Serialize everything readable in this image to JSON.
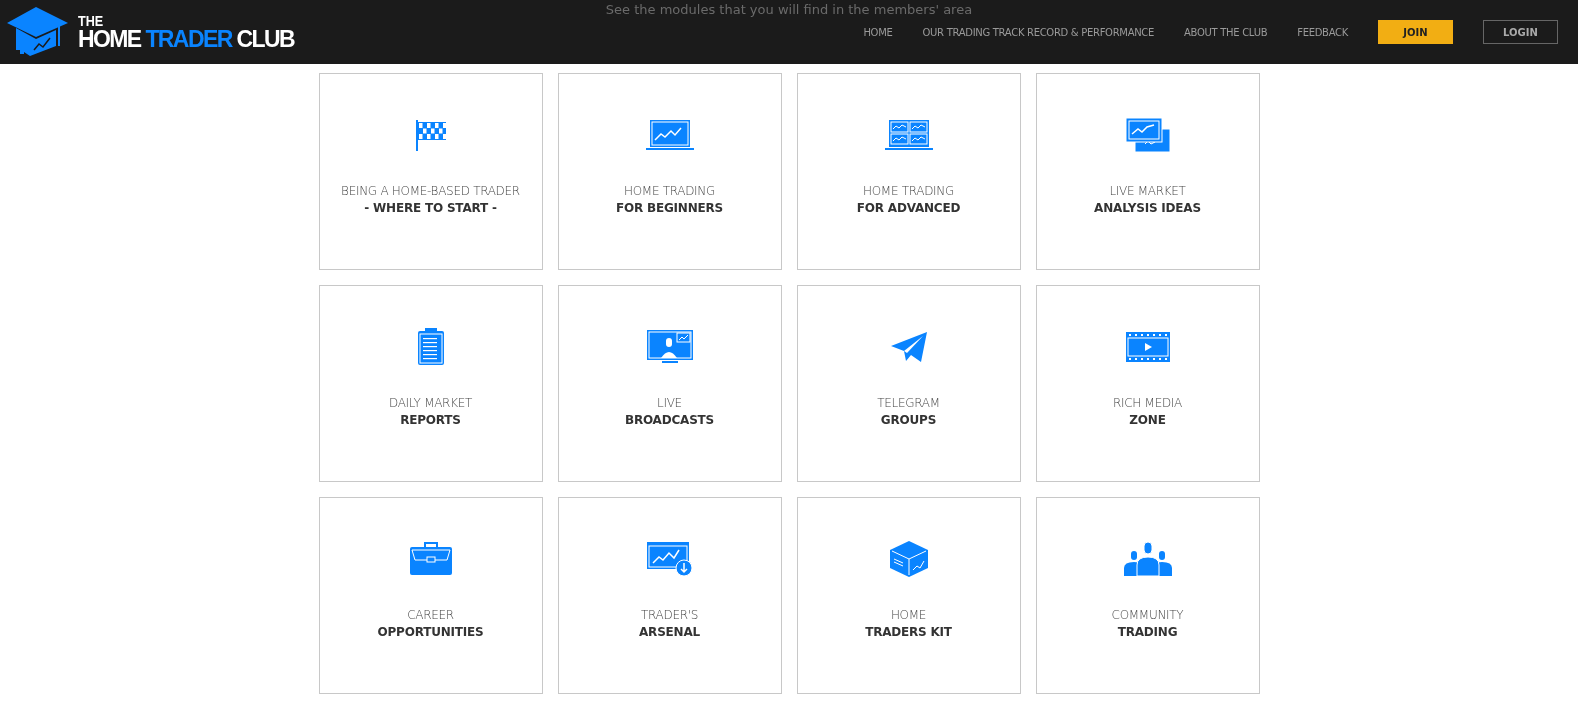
{
  "header": {
    "logo": {
      "line_1": "THE",
      "word_1": "HOME",
      "word_2": "TRADER",
      "word_3": "CLUB"
    },
    "hidden_intro": "See the modules that you will find in the members' area",
    "nav": [
      {
        "label": "HOME"
      },
      {
        "label": "OUR TRADING TRACK RECORD & PERFORMANCE"
      },
      {
        "label": "ABOUT THE CLUB"
      },
      {
        "label": "FEEDBACK"
      }
    ],
    "join_button": "JOIN",
    "login_button": "LOGIN"
  },
  "modules": [
    {
      "kind": "flag",
      "line_1": "BEING A HOME-BASED TRADER",
      "line_2": "- WHERE TO START -"
    },
    {
      "kind": "laptop",
      "line_1": "HOME TRADING",
      "line_2": "FOR BEGINNERS"
    },
    {
      "kind": "laptop-grid",
      "line_1": "HOME TRADING",
      "line_2": "FOR ADVANCED"
    },
    {
      "kind": "screens",
      "line_1": "LIVE MARKET",
      "line_2": "ANALYSIS IDEAS"
    },
    {
      "kind": "clipboard",
      "line_1": "DAILY MARKET",
      "line_2": "REPORTS"
    },
    {
      "kind": "broadcast",
      "line_1": "LIVE",
      "line_2": "BROADCASTS"
    },
    {
      "kind": "plane",
      "line_1": "TELEGRAM",
      "line_2": "GROUPS"
    },
    {
      "kind": "film",
      "line_1": "RICH MEDIA",
      "line_2": "ZONE"
    },
    {
      "kind": "briefcase",
      "line_1": "CAREER",
      "line_2": "OPPORTUNITIES"
    },
    {
      "kind": "download",
      "line_1": "TRADER'S",
      "line_2": "ARSENAL"
    },
    {
      "kind": "box",
      "line_1": "HOME",
      "line_2": "TRADERS KIT"
    },
    {
      "kind": "people",
      "line_1": "COMMUNITY",
      "line_2": "TRADING"
    }
  ]
}
